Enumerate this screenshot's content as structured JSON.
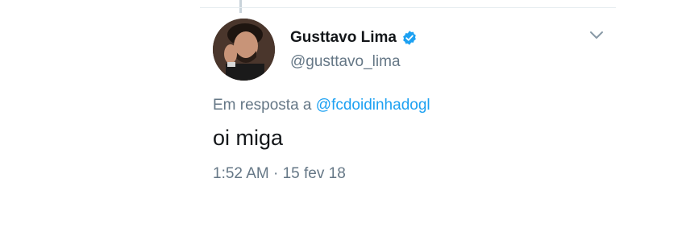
{
  "tweet": {
    "author": {
      "display_name": "Gusttavo Lima",
      "handle": "@gusttavo_lima",
      "verified": true
    },
    "reply": {
      "prefix": "Em resposta a",
      "mention": "@fcdoidinhadogl"
    },
    "text": "oi miga",
    "timestamp": "1:52 AM · 15 fev 18"
  },
  "icons": {
    "verified": "verified-badge-icon",
    "menu": "chevron-down-icon"
  },
  "colors": {
    "accent": "#1da1f2",
    "secondary_text": "#657786",
    "primary_text": "#14171a"
  }
}
